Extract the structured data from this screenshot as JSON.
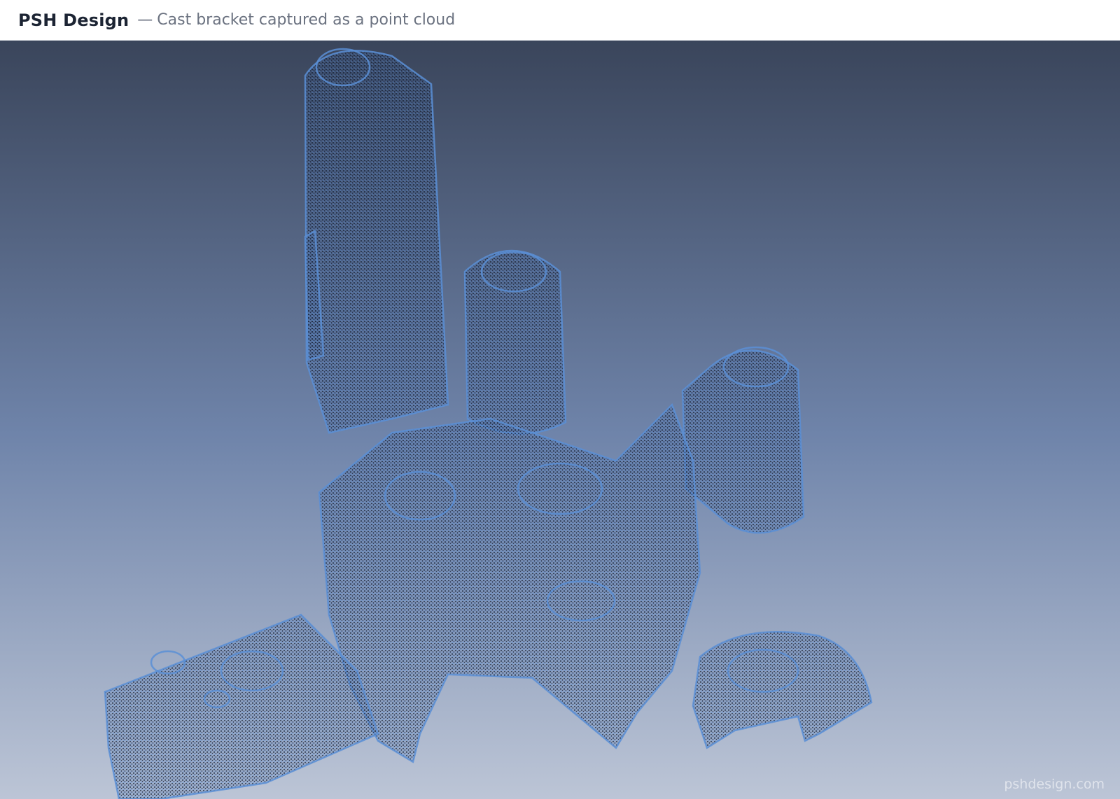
{
  "header": {
    "brand": "PSH Design",
    "separator": "—",
    "subtitle": "Cast bracket captured as a point cloud"
  },
  "viewport": {
    "subject": "point-cloud-bracket",
    "background_top": "#3a455b",
    "background_mid": "#6f84aa",
    "background_bottom": "#bcc5d6",
    "point_dark": "#0f1626",
    "point_highlight": "#5b8fd6",
    "watermark": "pshdesign.com"
  }
}
